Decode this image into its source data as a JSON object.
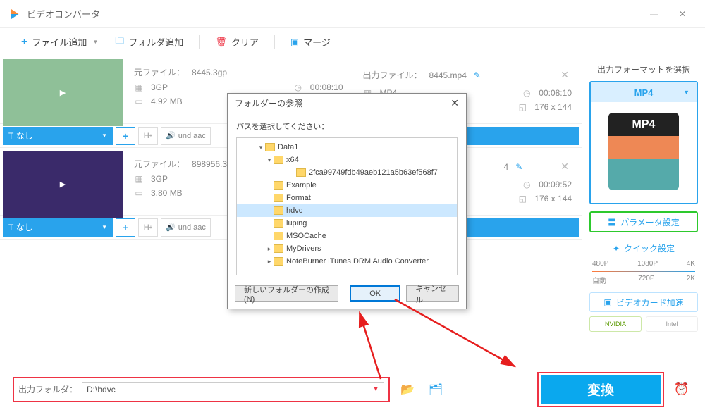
{
  "app": {
    "title": "ビデオコンバータ"
  },
  "toolbar": {
    "add_file": "ファイル追加",
    "add_folder": "フォルダ追加",
    "clear": "クリア",
    "merge": "マージ"
  },
  "files": [
    {
      "src_label": "元ファイル：",
      "src_name": "8445.3gp",
      "out_label": "出力ファイル：",
      "out_name": "8445.mp4",
      "src_format": "3GP",
      "src_dur": "00:08:10",
      "out_format": "MP4",
      "out_dur": "00:08:10",
      "src_size": "4.92 MB",
      "out_res": "176 x 144",
      "subtitle_mode": "なし",
      "audio_track": "und aac"
    },
    {
      "src_label": "元ファイル：",
      "src_name": "898956.3",
      "out_label": "出力ファイル：",
      "out_name": "4",
      "src_format": "3GP",
      "src_dur": "",
      "out_format": "",
      "out_dur": "00:09:52",
      "src_size": "3.80 MB",
      "out_res": "176 x 144",
      "subtitle_mode": "なし",
      "audio_track": "und aac"
    }
  ],
  "sidebar": {
    "title": "出力フォーマットを選択",
    "format": "MP4",
    "param_btn": "パラメータ設定",
    "quick_title": "クイック設定",
    "res_top": [
      "480P",
      "1080P",
      "4K"
    ],
    "res_bottom": [
      "自動",
      "720P",
      "2K"
    ],
    "gpu_btn": "ビデオカード加速",
    "vendor_nvidia": "NVIDIA",
    "vendor_intel": "Intel"
  },
  "bottom": {
    "out_folder_label": "出力フォルダ：",
    "out_folder_path": "D:\\hdvc",
    "convert": "変換"
  },
  "dialog": {
    "title": "フォルダーの参照",
    "hint": "パスを選択してください：",
    "nodes": [
      {
        "depth": "pad05",
        "exp": "▾",
        "label": "Data1"
      },
      {
        "depth": "pad1",
        "exp": "▾",
        "label": "x64"
      },
      {
        "depth": "pad3",
        "exp": "",
        "label": "2fca99749fdb49aeb121a5b63ef568f7"
      },
      {
        "depth": "pad1",
        "exp": "",
        "label": "Example"
      },
      {
        "depth": "pad1",
        "exp": "",
        "label": "Format"
      },
      {
        "depth": "pad1",
        "exp": "",
        "label": "hdvc",
        "selected": true
      },
      {
        "depth": "pad1",
        "exp": "",
        "label": "luping"
      },
      {
        "depth": "pad1",
        "exp": "",
        "label": "MSOCache"
      },
      {
        "depth": "pad1",
        "exp": "▸",
        "label": "MyDrivers"
      },
      {
        "depth": "pad1",
        "exp": "▸",
        "label": "NoteBurner iTunes DRM Audio Converter"
      }
    ],
    "new_folder": "新しいフォルダーの作成(N)",
    "ok": "OK",
    "cancel": "キャンセル"
  },
  "icons": {
    "subtitle_t": "T",
    "plus": "+",
    "hdr": "H",
    "audio": "🔊",
    "folder_open": "📂",
    "folder": "🗀",
    "clock": "⏰",
    "edit": "✎",
    "sliders": "〓"
  }
}
